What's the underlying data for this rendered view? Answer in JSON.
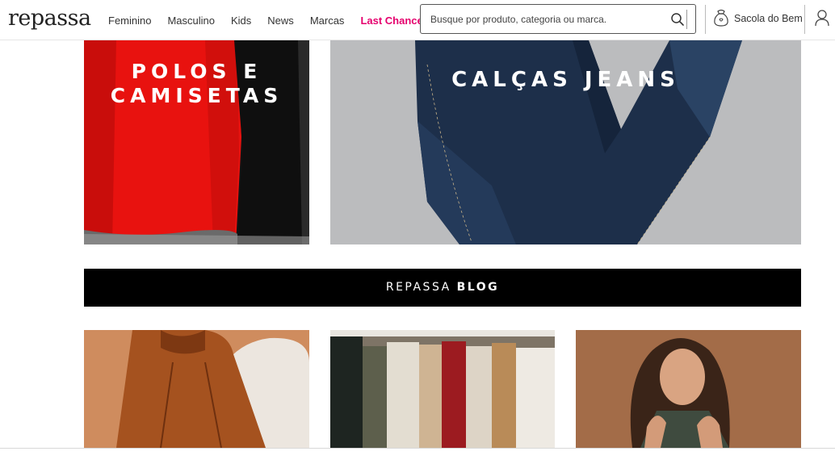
{
  "header": {
    "logo": "repassa",
    "nav": [
      {
        "label": "Feminino"
      },
      {
        "label": "Masculino"
      },
      {
        "label": "Kids"
      },
      {
        "label": "News"
      },
      {
        "label": "Marcas"
      },
      {
        "label": "Last Chance",
        "highlight": true,
        "color": "#e5006d"
      }
    ],
    "search": {
      "placeholder": "Busque por produto, categoria ou marca.",
      "value": ""
    },
    "bag_label": "Sacola do Bem",
    "icons": [
      "search-icon",
      "bag-icon",
      "user-icon"
    ]
  },
  "categories": [
    {
      "title_line1": "POLOS E",
      "title_line2": "CAMISETAS"
    },
    {
      "title": "CALÇAS JEANS"
    }
  ],
  "blog": {
    "prefix": "REPASSA ",
    "bold": "BLOG"
  },
  "colors": {
    "accent": "#e5006d",
    "banner": "#000000"
  }
}
